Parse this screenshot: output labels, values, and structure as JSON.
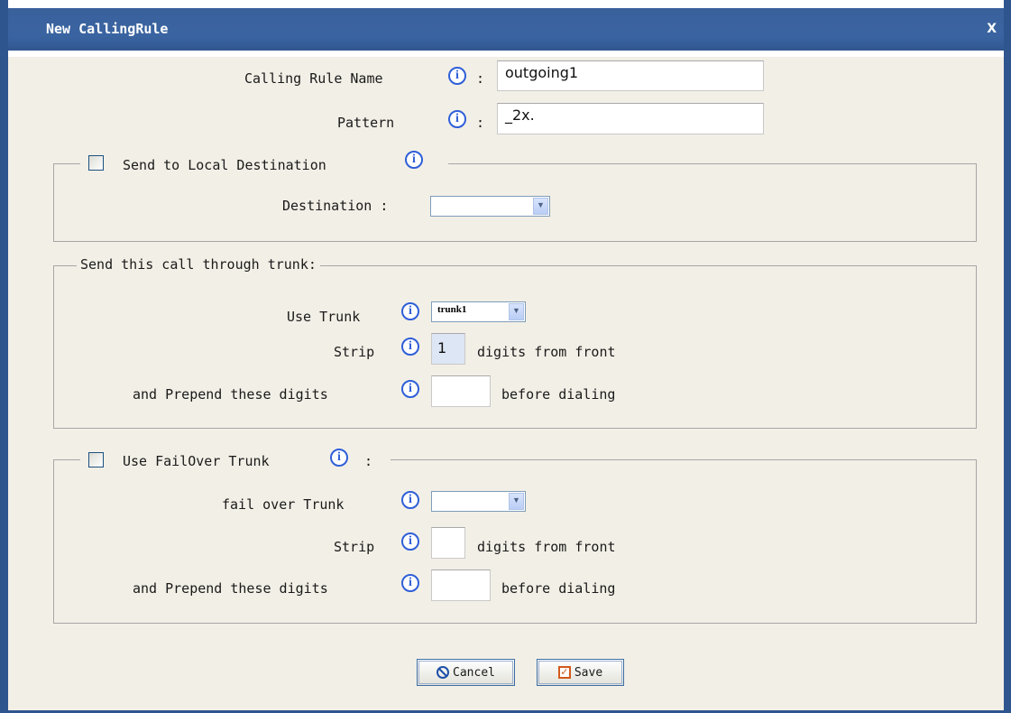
{
  "dialog": {
    "title": "New CallingRule",
    "close_label": "X"
  },
  "rule_name": {
    "label": "Calling Rule Name",
    "separator": ":",
    "value": "outgoing1"
  },
  "pattern": {
    "label": "Pattern",
    "separator": ":",
    "value": "_2x."
  },
  "local_destination": {
    "checkbox_label": "Send to Local Destination",
    "checked": false,
    "destination_label": "Destination :",
    "destination_value": ""
  },
  "trunk_section": {
    "legend": "Send this call through trunk:",
    "use_trunk_label": "Use Trunk",
    "use_trunk_value": "trunk1",
    "strip_label": "Strip",
    "strip_value": "1",
    "strip_suffix": "digits from front",
    "prepend_label": "and Prepend these digits",
    "prepend_value": "",
    "prepend_suffix": "before dialing"
  },
  "failover_section": {
    "checkbox_label": "Use FailOver Trunk",
    "checked": false,
    "separator": ":",
    "fail_over_label": "fail over Trunk",
    "fail_over_value": "",
    "strip_label": "Strip",
    "strip_value": "",
    "strip_suffix": "digits from front",
    "prepend_label": "and Prepend these digits",
    "prepend_value": "",
    "prepend_suffix": "before dialing"
  },
  "buttons": {
    "cancel": "Cancel",
    "save": "Save"
  },
  "icons": {
    "info": "info-icon",
    "cancel": "cancel-icon",
    "save": "checkmark-icon",
    "dropdown": "chevron-down-icon"
  },
  "colors": {
    "titlebar": "#3a64a1",
    "background": "#f2efe6",
    "info_icon": "#2f5fd8",
    "save_icon": "#d35a1c"
  }
}
